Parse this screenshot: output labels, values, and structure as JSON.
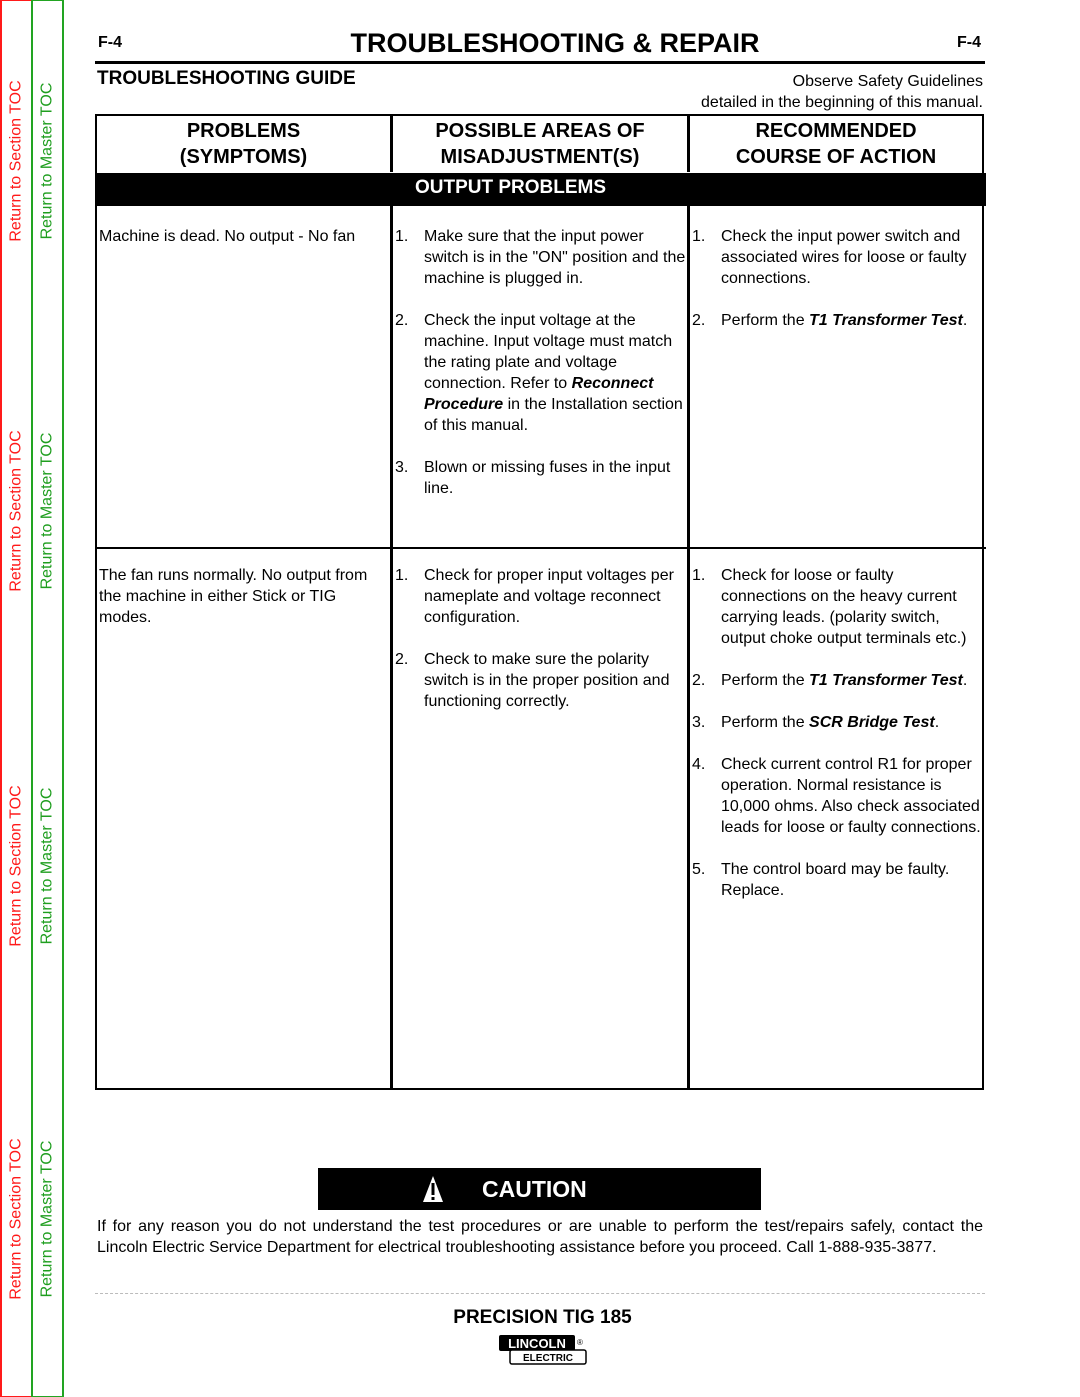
{
  "sidebar": {
    "section_toc_label": "Return to Section TOC",
    "master_toc_label": "Return to Master TOC"
  },
  "header": {
    "page_number_left": "F-4",
    "page_number_right": "F-4",
    "title": "TROUBLESHOOTING & REPAIR",
    "guide_title": "TROUBLESHOOTING GUIDE",
    "safety_line1": "Observe Safety Guidelines",
    "safety_line2": "detailed in the beginning of this manual."
  },
  "table": {
    "columns": [
      {
        "line1": "PROBLEMS",
        "line2": "(SYMPTOMS)"
      },
      {
        "line1": "POSSIBLE AREAS OF",
        "line2": "MISADJUSTMENT(S)"
      },
      {
        "line1": "RECOMMENDED",
        "line2": "COURSE OF ACTION"
      }
    ],
    "section_band": "OUTPUT PROBLEMS",
    "rows": [
      {
        "symptom": "Machine is dead.  No output - No fan",
        "areas": [
          {
            "num": "1.",
            "text": "Make sure that the input power switch is in the \"ON\" position and the machine is plugged in."
          },
          {
            "num": "2.",
            "pre": "Check the input voltage at the machine.  Input voltage must match the rating plate and voltage connection.  Refer to ",
            "emph": "Reconnect Procedure",
            "post": " in the Installation section of this manual."
          },
          {
            "num": "3.",
            "text": "Blown or missing fuses in the input line."
          }
        ],
        "actions": [
          {
            "num": "1.",
            "text": "Check the input power switch and associated wires for loose or faulty connections."
          },
          {
            "num": "2.",
            "pre": "Perform the ",
            "emph": "T1 Transformer Test",
            "post": "."
          }
        ]
      },
      {
        "symptom": "The fan runs normally.  No output from the machine in either Stick or TIG modes.",
        "areas": [
          {
            "num": "1.",
            "text": "Check for proper input voltages per nameplate and voltage reconnect configuration."
          },
          {
            "num": "2.",
            "text": "Check to make sure the polarity switch is in the proper position and functioning correctly."
          }
        ],
        "actions": [
          {
            "num": "1.",
            "text": "Check for loose or faulty connections on the heavy current carrying leads.  (polarity switch, output choke output terminals etc.)"
          },
          {
            "num": "2.",
            "pre": "Perform the ",
            "emph": "T1 Transformer Test",
            "post": "."
          },
          {
            "num": "3.",
            "pre": "Perform the ",
            "emph": "SCR Bridge Test",
            "post": "."
          },
          {
            "num": "4.",
            "text": "Check current control R1 for proper operation.  Normal resistance is 10,000 ohms.  Also check associated leads  for loose or faulty connections."
          },
          {
            "num": "5.",
            "text": "The control board may be faulty. Replace."
          }
        ]
      }
    ]
  },
  "caution": {
    "icon": "warning-triangle-icon",
    "label": "CAUTION",
    "text": "If for any reason you do not understand the test procedures or are unable to perform the test/repairs safely, contact the Lincoln Electric Service Department for electrical troubleshooting assistance before you proceed.  Call 1-888-935-3877."
  },
  "footer": {
    "model": "PRECISION TIG 185",
    "logo_top": "LINCOLN",
    "logo_bottom": "ELECTRIC",
    "logo_mark": "®"
  }
}
